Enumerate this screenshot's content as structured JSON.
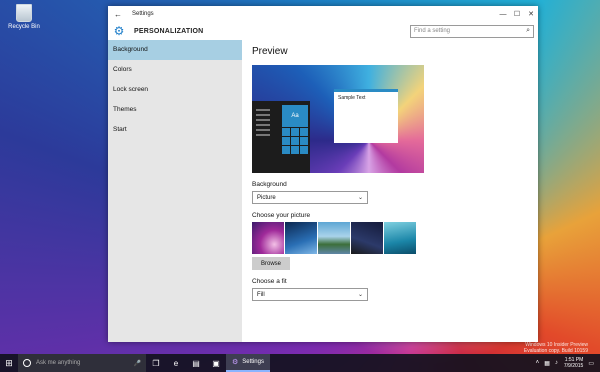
{
  "desktop": {
    "recycle_bin_label": "Recycle Bin",
    "watermark_line1": "Windows 10 Insider Preview",
    "watermark_line2": "Evaluation copy. Build 10159"
  },
  "window": {
    "title": "Settings",
    "header_title": "PERSONALIZATION",
    "search_placeholder": "Find a setting",
    "accent_color": "#1a7cc9"
  },
  "nav": {
    "items": [
      {
        "label": "Background",
        "active": true
      },
      {
        "label": "Colors",
        "active": false
      },
      {
        "label": "Lock screen",
        "active": false
      },
      {
        "label": "Themes",
        "active": false
      },
      {
        "label": "Start",
        "active": false
      }
    ]
  },
  "content": {
    "preview_heading": "Preview",
    "preview_window_text": "Sample Text",
    "preview_tile_label": "Aa",
    "background_label": "Background",
    "background_value": "Picture",
    "choose_picture_label": "Choose your picture",
    "browse_label": "Browse",
    "choose_fit_label": "Choose a fit",
    "fit_value": "Fill"
  },
  "taskbar": {
    "search_placeholder": "Ask me anything",
    "active_app_label": "Settings",
    "clock_time": "1:51 PM",
    "clock_date": "7/9/2015"
  }
}
